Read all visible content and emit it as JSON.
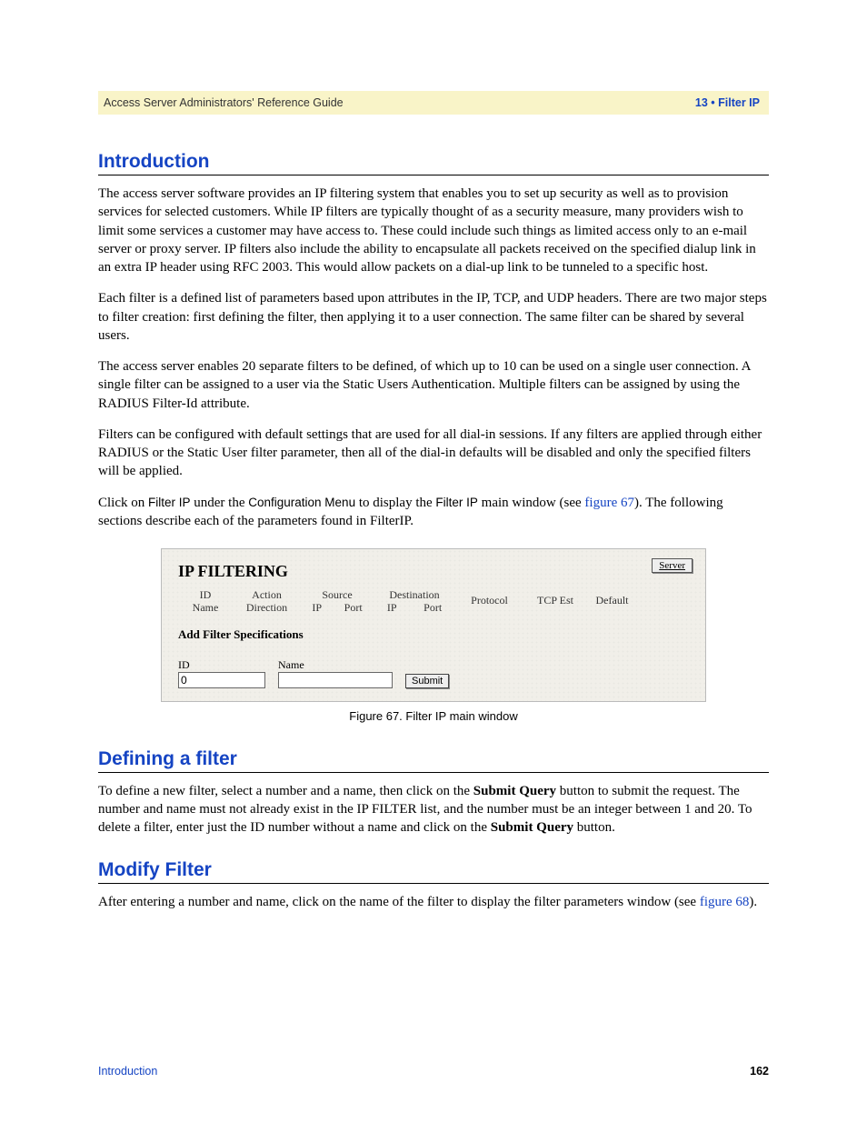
{
  "header": {
    "left": "Access Server Administrators' Reference Guide",
    "right": "13 • Filter IP"
  },
  "sections": {
    "intro_title": "Introduction",
    "defining_title": "Defining a filter",
    "modify_title": "Modify Filter"
  },
  "paragraphs": {
    "intro_p1": "The access server software provides an IP filtering system that enables you to set up security as well as to provision services for selected customers. While IP filters are typically thought of as a security measure, many providers wish to limit some services a customer may have access to. These could include such things as limited access only to an e-mail server or proxy server. IP filters also include the ability to encapsulate all packets received on the specified dialup link in an extra IP header using RFC 2003. This would allow packets on a dial-up link to be tunneled to a specific host.",
    "intro_p2": "Each filter is a defined list of parameters based upon attributes in the IP, TCP, and UDP headers. There are two major steps to filter creation: first defining the filter, then applying it to a user connection. The same filter can be shared by several users.",
    "intro_p3": "The access server enables 20 separate filters to be defined, of which up to 10 can be used on a single user connection. A single filter can be assigned to a user via the Static Users Authentication. Multiple filters can be assigned by using the RADIUS Filter-Id attribute.",
    "intro_p4": "Filters can be configured with default settings that are used for all dial-in sessions. If any filters are applied through either RADIUS or the Static User filter parameter, then all of the dial-in defaults will be disabled and only the specified filters will be applied.",
    "intro_p5_a": "Click on ",
    "intro_p5_filterip": "Filter IP",
    "intro_p5_b": " under the ",
    "intro_p5_confmenu": "Configuration Menu",
    "intro_p5_c": " to display the ",
    "intro_p5_filterip2": "Filter IP",
    "intro_p5_d": " main window (see ",
    "intro_p5_link": "figure 67",
    "intro_p5_e": "). The following sections describe each of the parameters found in FilterIP.",
    "defining_p1_a": "To define a new filter, select a number and a name, then click on the ",
    "defining_p1_b": "Submit Query",
    "defining_p1_c": " button to submit the request. The number and name must not already exist in the IP FILTER list, and the number must be an integer between 1 and 20. To delete a filter, enter just the ID number without a name and click on the ",
    "defining_p1_d": "Submit Query",
    "defining_p1_e": " button.",
    "modify_p1_a": "After entering a number and name, click on the name of the filter to display the filter parameters window (see ",
    "modify_p1_link": "figure 68",
    "modify_p1_b": ")."
  },
  "figure": {
    "title": "IP FILTERING",
    "server_btn": "Server",
    "cols": {
      "id": "ID",
      "name": "Name",
      "action": "Action",
      "direction": "Direction",
      "source": "Source",
      "destination": "Destination",
      "ip": "IP",
      "port": "Port",
      "protocol": "Protocol",
      "tcpest": "TCP Est",
      "default": "Default"
    },
    "subheading": "Add Filter Specifications",
    "form": {
      "id_label": "ID",
      "id_value": "0",
      "name_label": "Name",
      "name_value": "",
      "submit": "Submit"
    },
    "caption": "Figure 67. Filter IP main window"
  },
  "footer": {
    "left": "Introduction",
    "right": "162"
  }
}
